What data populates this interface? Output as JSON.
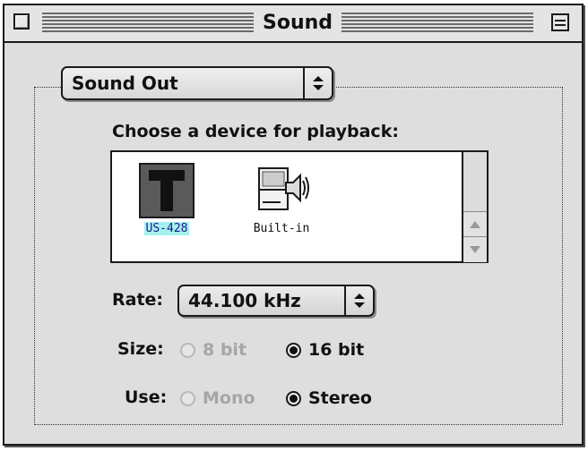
{
  "window": {
    "title": "Sound"
  },
  "panel": {
    "popup_label": "Sound Out"
  },
  "playback": {
    "prompt": "Choose a device for playback:",
    "devices": [
      {
        "label": "US-428",
        "icon": "tascam-t-icon",
        "selected": true
      },
      {
        "label": "Built-in",
        "icon": "computer-speaker-icon",
        "selected": false
      }
    ]
  },
  "rate": {
    "label": "Rate:",
    "value": "44.100 kHz"
  },
  "size": {
    "label": "Size:",
    "options": [
      {
        "label": "8 bit",
        "checked": false,
        "enabled": false
      },
      {
        "label": "16 bit",
        "checked": true,
        "enabled": true
      }
    ]
  },
  "use": {
    "label": "Use:",
    "options": [
      {
        "label": "Mono",
        "checked": false,
        "enabled": false
      },
      {
        "label": "Stereo",
        "checked": true,
        "enabled": true
      }
    ]
  },
  "colors": {
    "window_bg": "#dedede",
    "selection_highlight": "#a6f0f0",
    "disabled_text": "#a6a6a6"
  }
}
